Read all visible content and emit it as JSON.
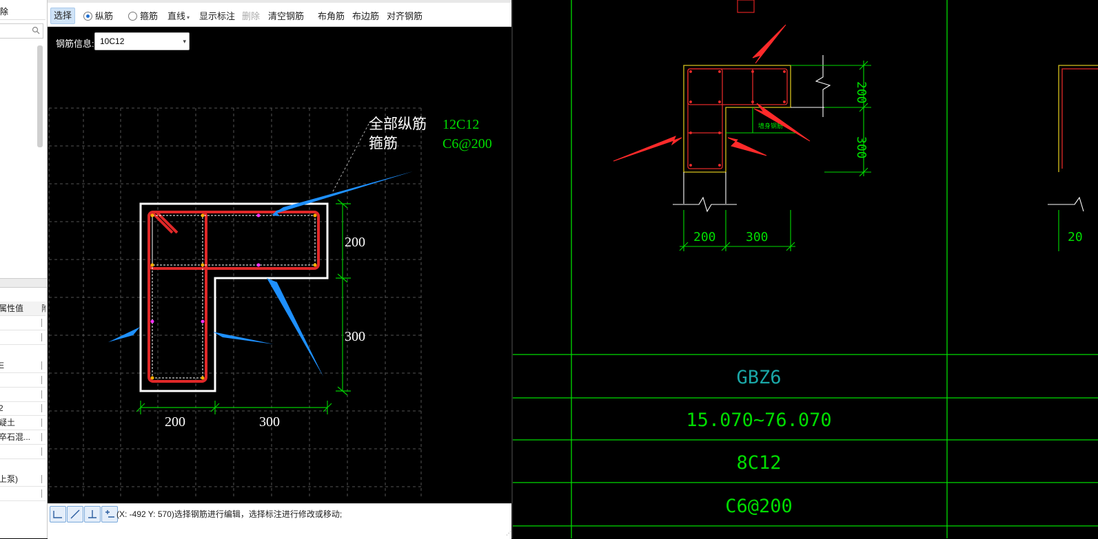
{
  "left_panel": {
    "top_label": "除",
    "section_header": "属性值",
    "section_header_right": "附",
    "rows": [
      "",
      "",
      "E",
      "",
      "",
      "2",
      "疑土",
      "卒石混...",
      "",
      "上泵)",
      ""
    ]
  },
  "toolbar": {
    "select_label": "选择",
    "longitudinal_label": "纵筋",
    "stirrup_label": "箍筋",
    "line_mode_label": "直线",
    "show_dims_label": "显示标注",
    "delete_label": "删除",
    "clear_label": "清空钢筋",
    "corner_rebar_label": "布角筋",
    "edge_rebar_label": "布边筋",
    "align_rebar_label": "对齐钢筋"
  },
  "info": {
    "label": "钢筋信息:",
    "value": "10C12"
  },
  "drawing": {
    "callout_main": "全部纵筋",
    "callout_stirrup": "箍筋",
    "main_value": "12C12",
    "stirrup_value": "C6@200",
    "dim_h1": "200",
    "dim_h2": "300",
    "dim_v1": "200",
    "dim_v2": "300"
  },
  "status": {
    "text": "(X: -492 Y: 570)选择钢筋进行编辑，选择标注进行修改或移动;"
  },
  "cad": {
    "dim_200_v": "200",
    "dim_300_v": "300",
    "dim_200_h": "200",
    "dim_300_h": "300",
    "web_label": "墙身钢筋",
    "right_dim_partial": "20",
    "table": {
      "name": "GBZ6",
      "elevation": "15.070~76.070",
      "main_rebar": "8C12",
      "stirrup": "C6@200"
    }
  },
  "colors": {
    "rebar_red": "#e02828",
    "cad_green": "#00ff00",
    "arrow_blue": "#1e90ff",
    "arrow_red": "#ff2a2a",
    "name_cyan": "#1aa7a7"
  }
}
